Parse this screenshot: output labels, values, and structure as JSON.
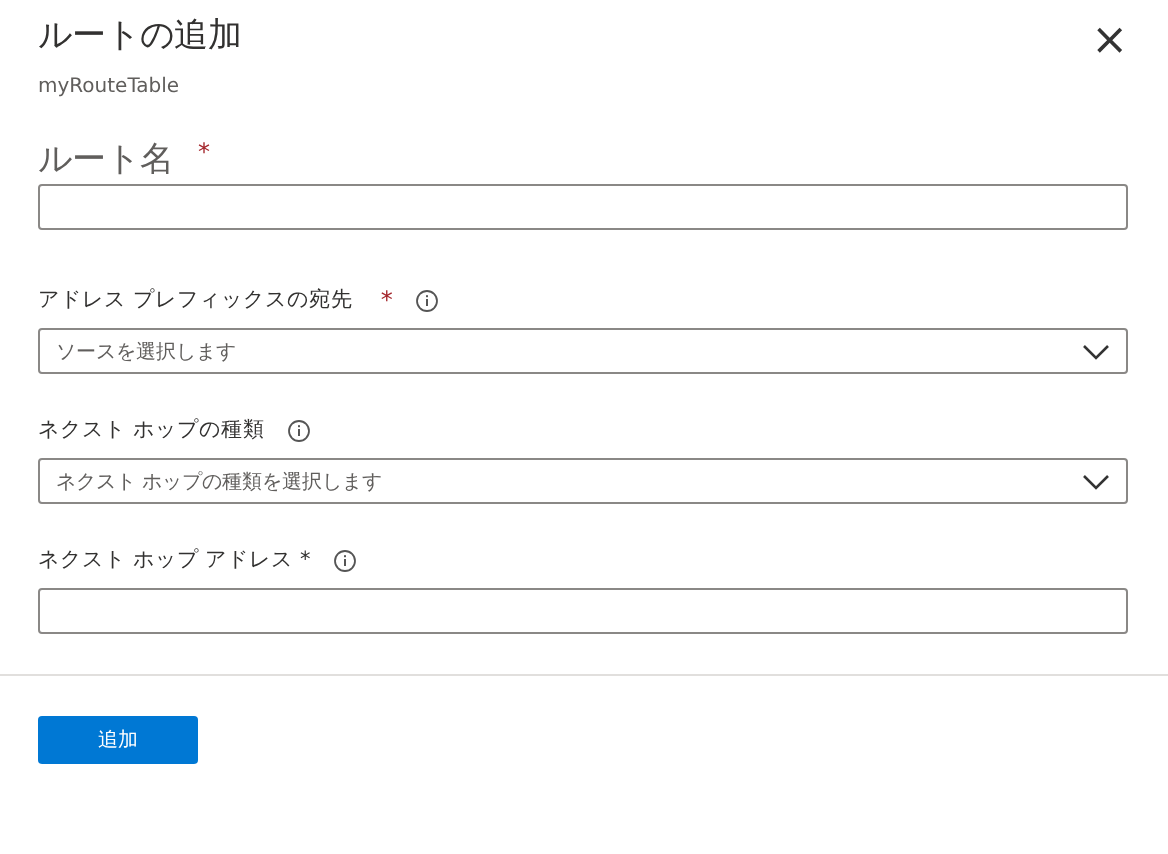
{
  "panel": {
    "title": "ルートの追加",
    "subtitle": "myRouteTable",
    "close": "×"
  },
  "fields": [
    {
      "kind": "text",
      "label": "ルート名",
      "large": true,
      "required_mark": "*"
    },
    {
      "kind": "select",
      "label": "アドレス プレフィックスの宛先",
      "large": false,
      "required_mark": "*",
      "info": true,
      "placeholder": "ソースを選択します"
    },
    {
      "kind": "select",
      "label": "ネクスト ホップの種類",
      "large": false,
      "info": true,
      "placeholder": "ネクスト ホップの種類を選択します"
    },
    {
      "kind": "text",
      "label": "ネクスト ホップ アドレス *",
      "large": false,
      "info": true
    }
  ],
  "footer": {
    "button": "追加"
  }
}
